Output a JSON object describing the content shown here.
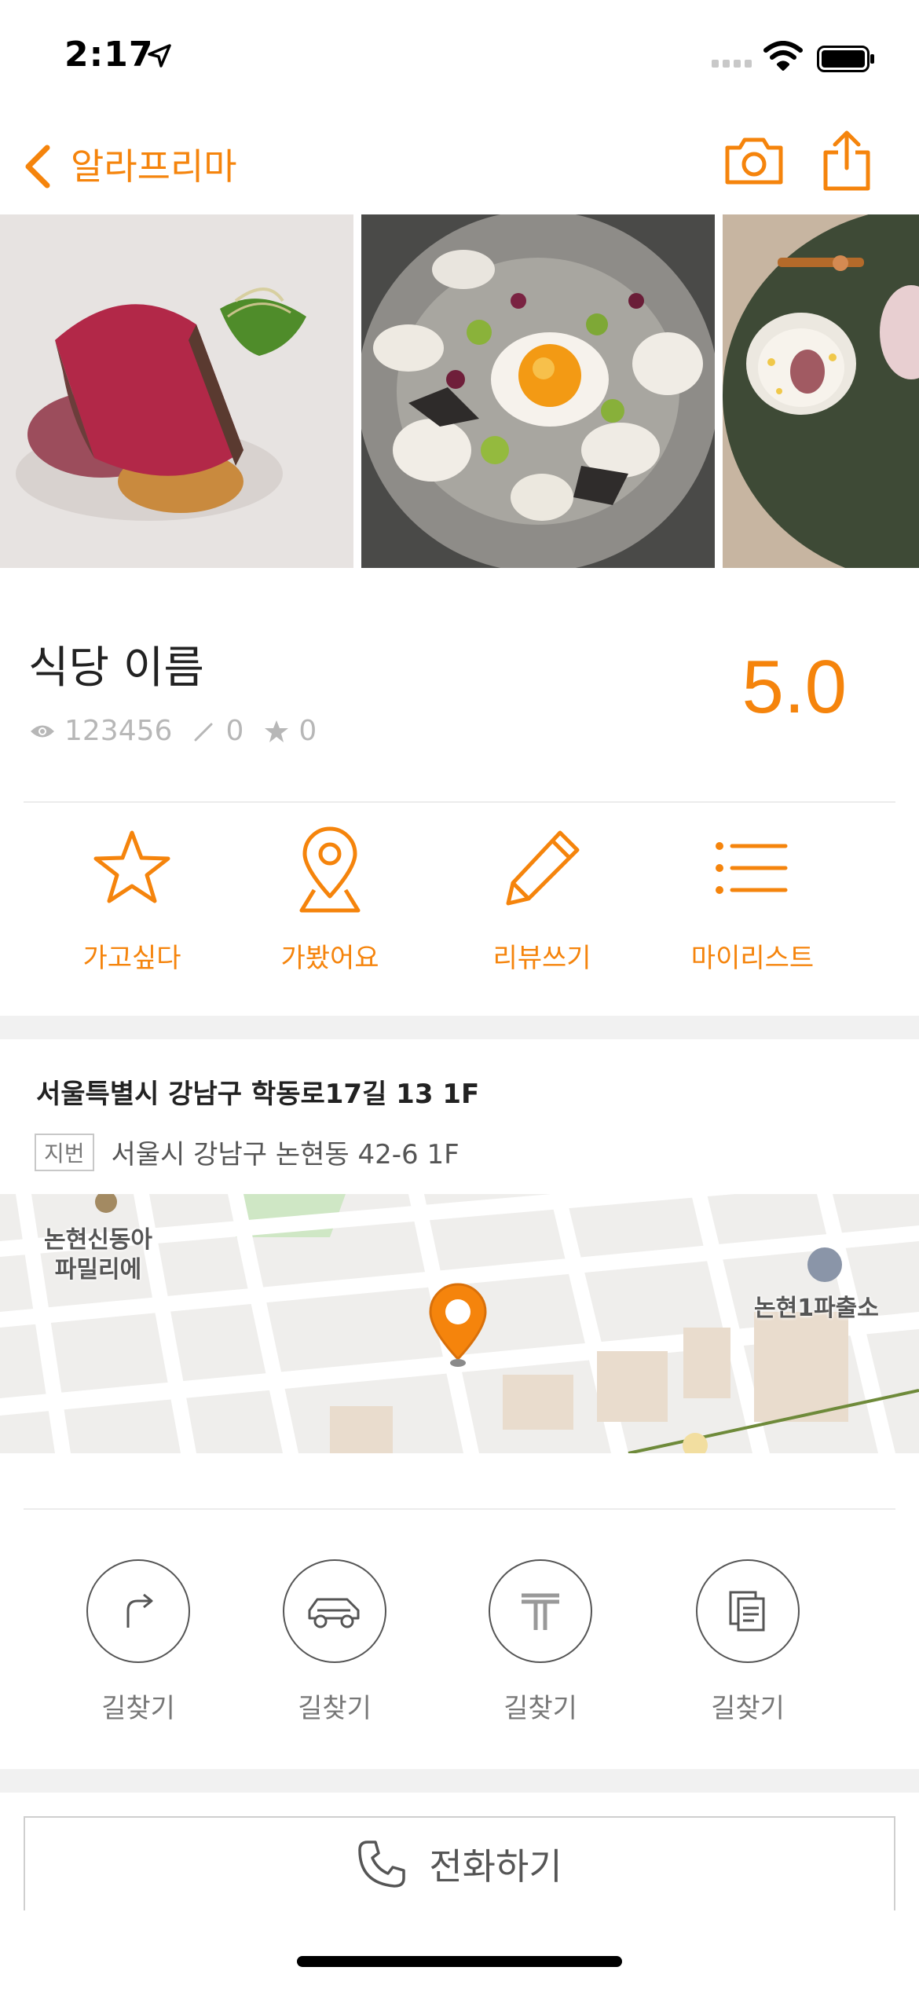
{
  "status_bar": {
    "time": "2:17",
    "icons": [
      "location-arrow-icon",
      "cellular-signal-icon",
      "wifi-icon",
      "battery-icon"
    ]
  },
  "nav": {
    "title": "알라프리마",
    "icons": [
      "back-chevron-icon",
      "camera-icon",
      "share-icon"
    ]
  },
  "colors": {
    "accent": "#f5840c",
    "text": "#222222",
    "muted": "#b7b7b7",
    "band": "#f1f1f1"
  },
  "photos": [
    "seared-beef-photo",
    "mushroom-egg-salad-photo",
    "soup-bowl-photo"
  ],
  "restaurant": {
    "name": "식당 이름",
    "views": "123456",
    "reviews": "0",
    "stars": "0",
    "rating": "5.0"
  },
  "actions": [
    {
      "label": "가고싶다",
      "icon": "star-outline-icon"
    },
    {
      "label": "가봤어요",
      "icon": "map-pin-icon"
    },
    {
      "label": "리뷰쓰기",
      "icon": "pencil-icon"
    },
    {
      "label": "마이리스트",
      "icon": "list-icon"
    }
  ],
  "address": {
    "road": "서울특별시 강남구 학동로17길 13 1F",
    "jibun_badge": "지번",
    "jibun": "서울시 강남구 논현동 42-6 1F"
  },
  "map": {
    "labels": [
      "논현신동아\n파밀리에",
      "논현1파출소"
    ],
    "marker": "location-marker-icon"
  },
  "directions": [
    {
      "label": "길찾기",
      "icon": "turn-right-arrow-icon"
    },
    {
      "label": "길찾기",
      "icon": "car-icon"
    },
    {
      "label": "길찾기",
      "icon": "taxi-t-icon"
    },
    {
      "label": "길찾기",
      "icon": "copy-document-icon"
    }
  ],
  "call": {
    "label": "전화하기",
    "icon": "phone-icon"
  }
}
